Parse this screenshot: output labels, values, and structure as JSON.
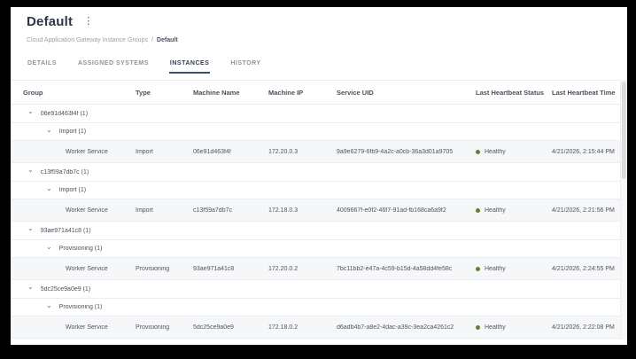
{
  "header": {
    "title": "Default",
    "kebab_icon": "kebab-menu"
  },
  "breadcrumb": {
    "parent": "Cloud Application Gateway Instance Groups",
    "separator": "/",
    "current": "Default"
  },
  "tabs": [
    {
      "label": "DETAILS",
      "active": false
    },
    {
      "label": "ASSIGNED SYSTEMS",
      "active": false
    },
    {
      "label": "INSTANCES",
      "active": true
    },
    {
      "label": "HISTORY",
      "active": false
    }
  ],
  "table": {
    "columns": [
      "Group",
      "Type",
      "Machine Name",
      "Machine IP",
      "Service UID",
      "Last Heartbeat Status",
      "Last Heartbeat Time"
    ],
    "instance_label": "Worker Service",
    "status_color": "#5c832f",
    "groups": [
      {
        "name": "06e91d463f4f (1)",
        "subgroup": "Import (1)",
        "instance": {
          "type": "Import",
          "machine_name": "06e91d463f4f",
          "machine_ip": "172.20.0.3",
          "service_uid": "9a9e6279-6fb9-4a2c-a0cb-36a3d01a9705",
          "status": "Healthy",
          "time": "4/21/2026, 2:15:44 PM"
        }
      },
      {
        "name": "c13f59a7db7c (1)",
        "subgroup": "Import (1)",
        "instance": {
          "type": "Import",
          "machine_name": "c13f59a7db7c",
          "machine_ip": "172.18.0.3",
          "service_uid": "4009667f-e0f2-46f7-91ad-fb168ca6a9f2",
          "status": "Healthy",
          "time": "4/21/2026, 2:21:56 PM"
        }
      },
      {
        "name": "93ae971a41c8 (1)",
        "subgroup": "Provisioning (1)",
        "instance": {
          "type": "Provisioning",
          "machine_name": "93ae971a41c8",
          "machine_ip": "172.20.0.2",
          "service_uid": "7bc11bb2-e47a-4c59-b15d-4a58dd4fe58c",
          "status": "Healthy",
          "time": "4/21/2026, 2:24:55 PM"
        }
      },
      {
        "name": "5dc25ce9a0e9 (1)",
        "subgroup": "Provisioning (1)",
        "instance": {
          "type": "Provisioning",
          "machine_name": "5dc25ce9a0e9",
          "machine_ip": "172.18.0.2",
          "service_uid": "d6adb4b7-a8e2-4dac-a39c-3ea2ca4261c2",
          "status": "Healthy",
          "time": "4/21/2026, 2:22:08 PM"
        }
      }
    ]
  }
}
